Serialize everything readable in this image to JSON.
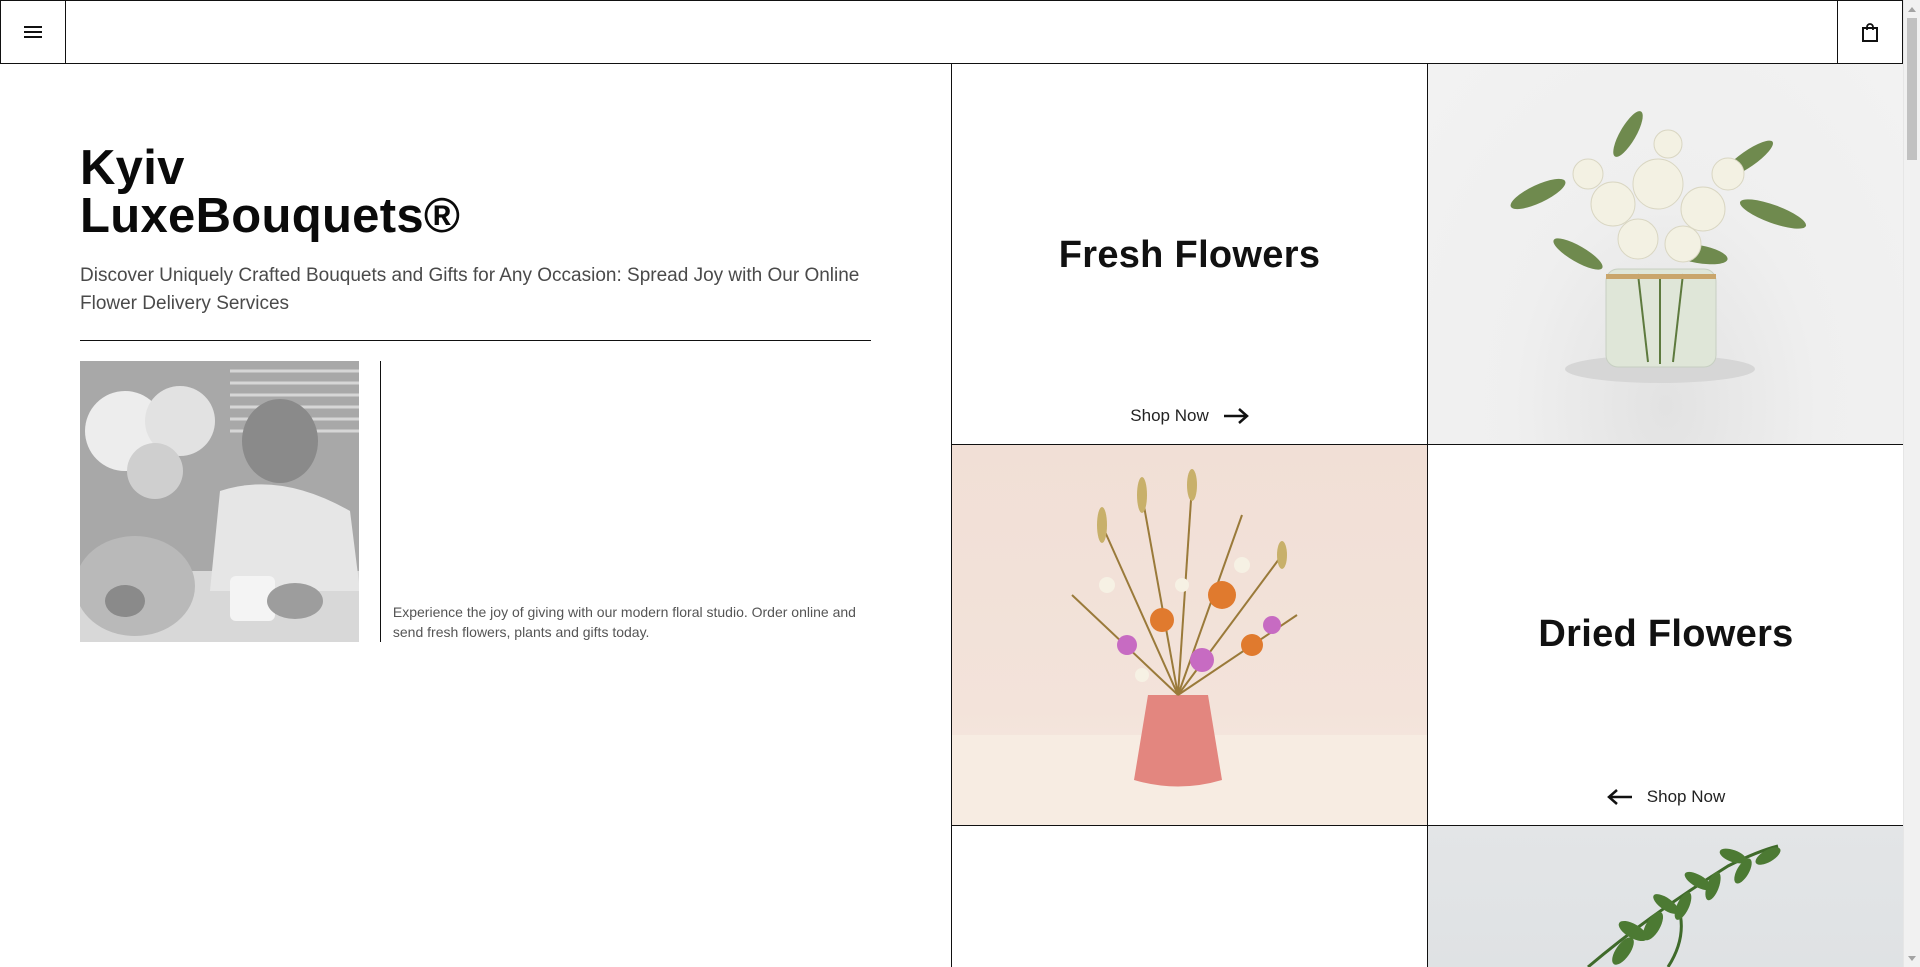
{
  "header": {
    "menu_icon": "menu-icon",
    "cart_icon": "shopping-bag-icon"
  },
  "hero": {
    "title": "Kyiv\nLuxeBouquets®",
    "subtitle": "Discover Uniquely Crafted Bouquets and Gifts for Any Occasion: Spread Joy with Our Online Flower Delivery Services",
    "description": "Experience the joy of giving with our modern floral studio. Order online and send fresh flowers, plants and gifts today."
  },
  "categories": [
    {
      "title": "Fresh Flowers",
      "link": "Shop Now",
      "arrow": "arrow-right-icon"
    },
    {
      "title": "Dried Flowers",
      "link": "Shop Now",
      "arrow": "arrow-left-icon"
    }
  ],
  "colors": {
    "border": "#111111",
    "text": "#111111",
    "subtext": "#4a4a4a",
    "vase_pink": "#e3867f"
  }
}
